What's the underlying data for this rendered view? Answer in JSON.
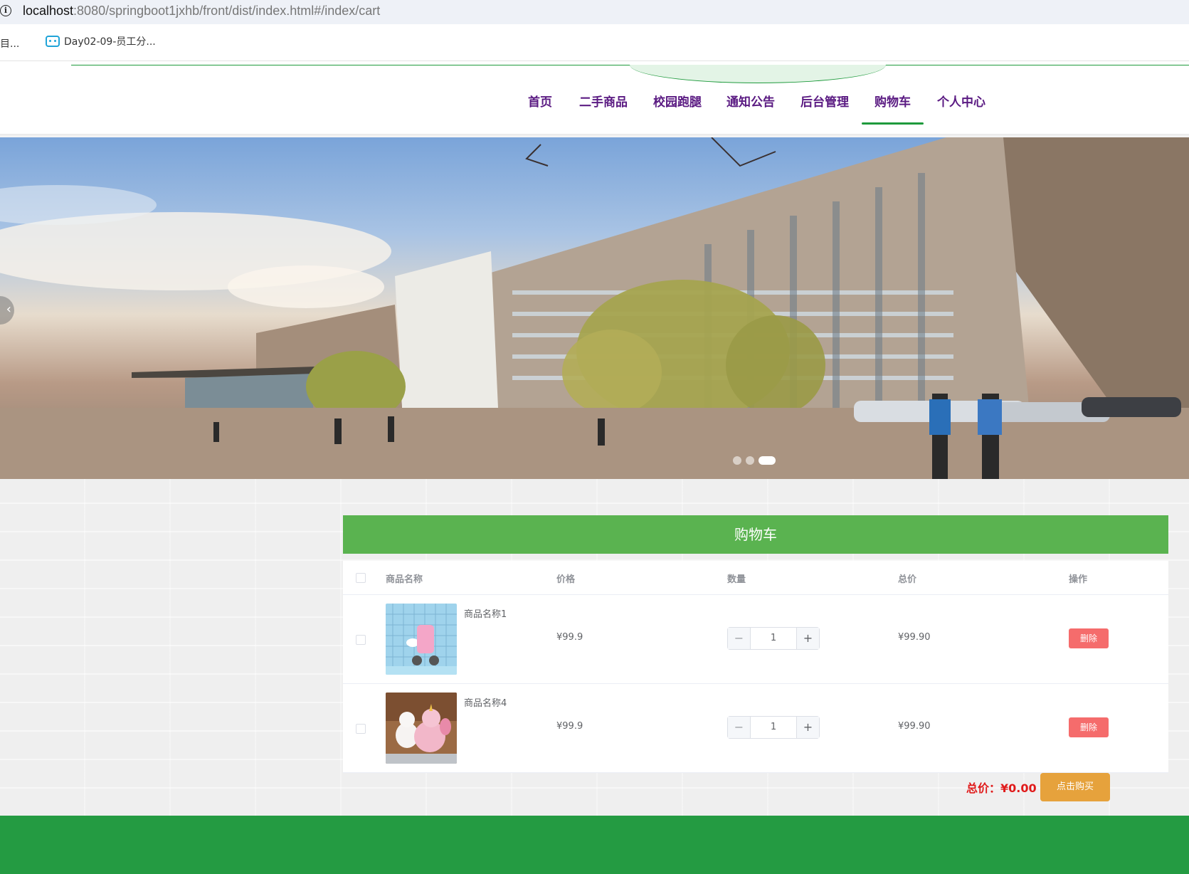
{
  "browser": {
    "url_host": "localhost",
    "url_rest": ":8080/springboot1jxhb/front/dist/index.html#/index/cart",
    "bookmarks": [
      "目...",
      "Day02-09-员工分..."
    ]
  },
  "nav": {
    "items": [
      "首页",
      "二手商品",
      "校园跑腿",
      "通知公告",
      "后台管理",
      "购物车",
      "个人中心"
    ],
    "active": "购物车"
  },
  "carousel": {
    "prev_glyph": "‹",
    "slide_count": 3,
    "active_index": 2
  },
  "cart": {
    "title": "购物车",
    "columns": {
      "name": "商品名称",
      "price": "价格",
      "quantity": "数量",
      "total": "总价",
      "action": "操作"
    },
    "rows": [
      {
        "name": "商品名称1",
        "price": "¥99.9",
        "quantity": "1",
        "total": "¥99.90",
        "delete_label": "删除",
        "checked": false
      },
      {
        "name": "商品名称4",
        "price": "¥99.9",
        "quantity": "1",
        "total": "¥99.90",
        "delete_label": "删除",
        "checked": false
      }
    ],
    "stepper": {
      "minus": "−",
      "plus": "+"
    },
    "summary_label": "总价：¥0.00",
    "buy_label": "点击购买"
  },
  "colors": {
    "brand_green": "#5ab350",
    "footer_green": "#249b42",
    "nav_text": "#5a1a82",
    "danger": "#f56c6c",
    "warning": "#e6a23c",
    "total_red": "#e01a1a"
  }
}
